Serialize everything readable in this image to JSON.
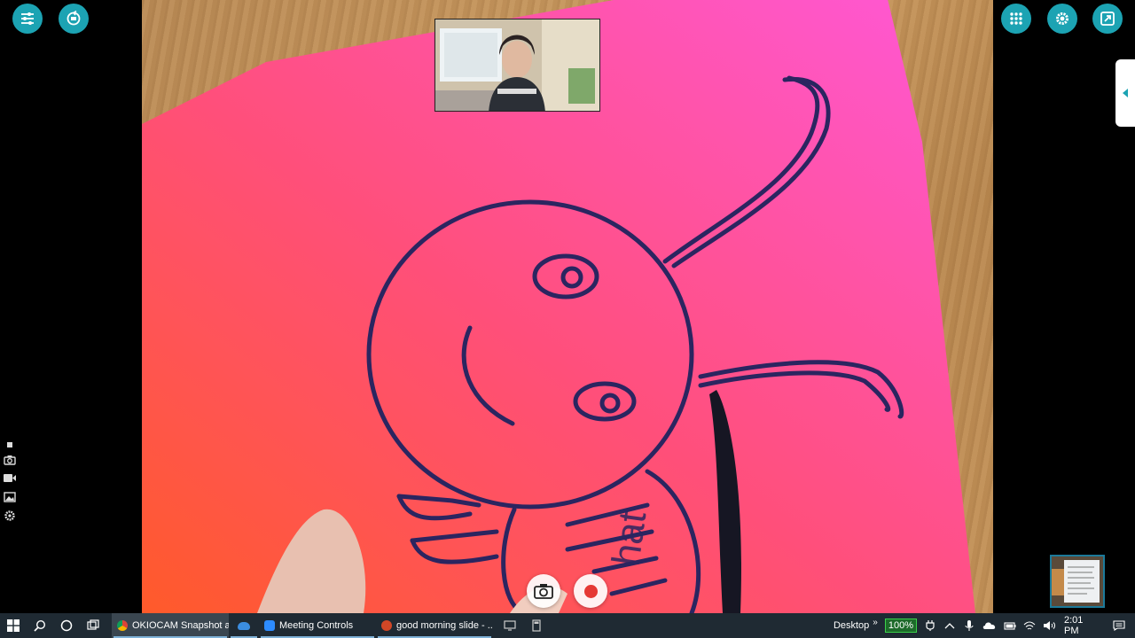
{
  "camera": {
    "handwritten_text": "hat"
  },
  "taskbar": {
    "apps": [
      {
        "label": "OKIOCAM Snapshot a...",
        "icon": "chrome-icon",
        "color": "#e8b23a"
      },
      {
        "label": "",
        "icon": "onedrive-icon",
        "color": "#3b8de0"
      },
      {
        "label": "Meeting Controls",
        "icon": "zoom-icon",
        "color": "#2d8cff"
      },
      {
        "label": "good morning slide - ...",
        "icon": "powerpoint-icon",
        "color": "#d24726"
      },
      {
        "label": "",
        "icon": "monitor-icon",
        "color": "#ccc"
      },
      {
        "label": "",
        "icon": "calculator-icon",
        "color": "#ccc"
      }
    ],
    "desktop_label": "Desktop",
    "desktop_chevron": "»",
    "battery_percent": "100%",
    "time": "2:01 PM"
  },
  "colors": {
    "accent": "#1ca3b3",
    "taskbar_bg": "#1f2a33"
  }
}
